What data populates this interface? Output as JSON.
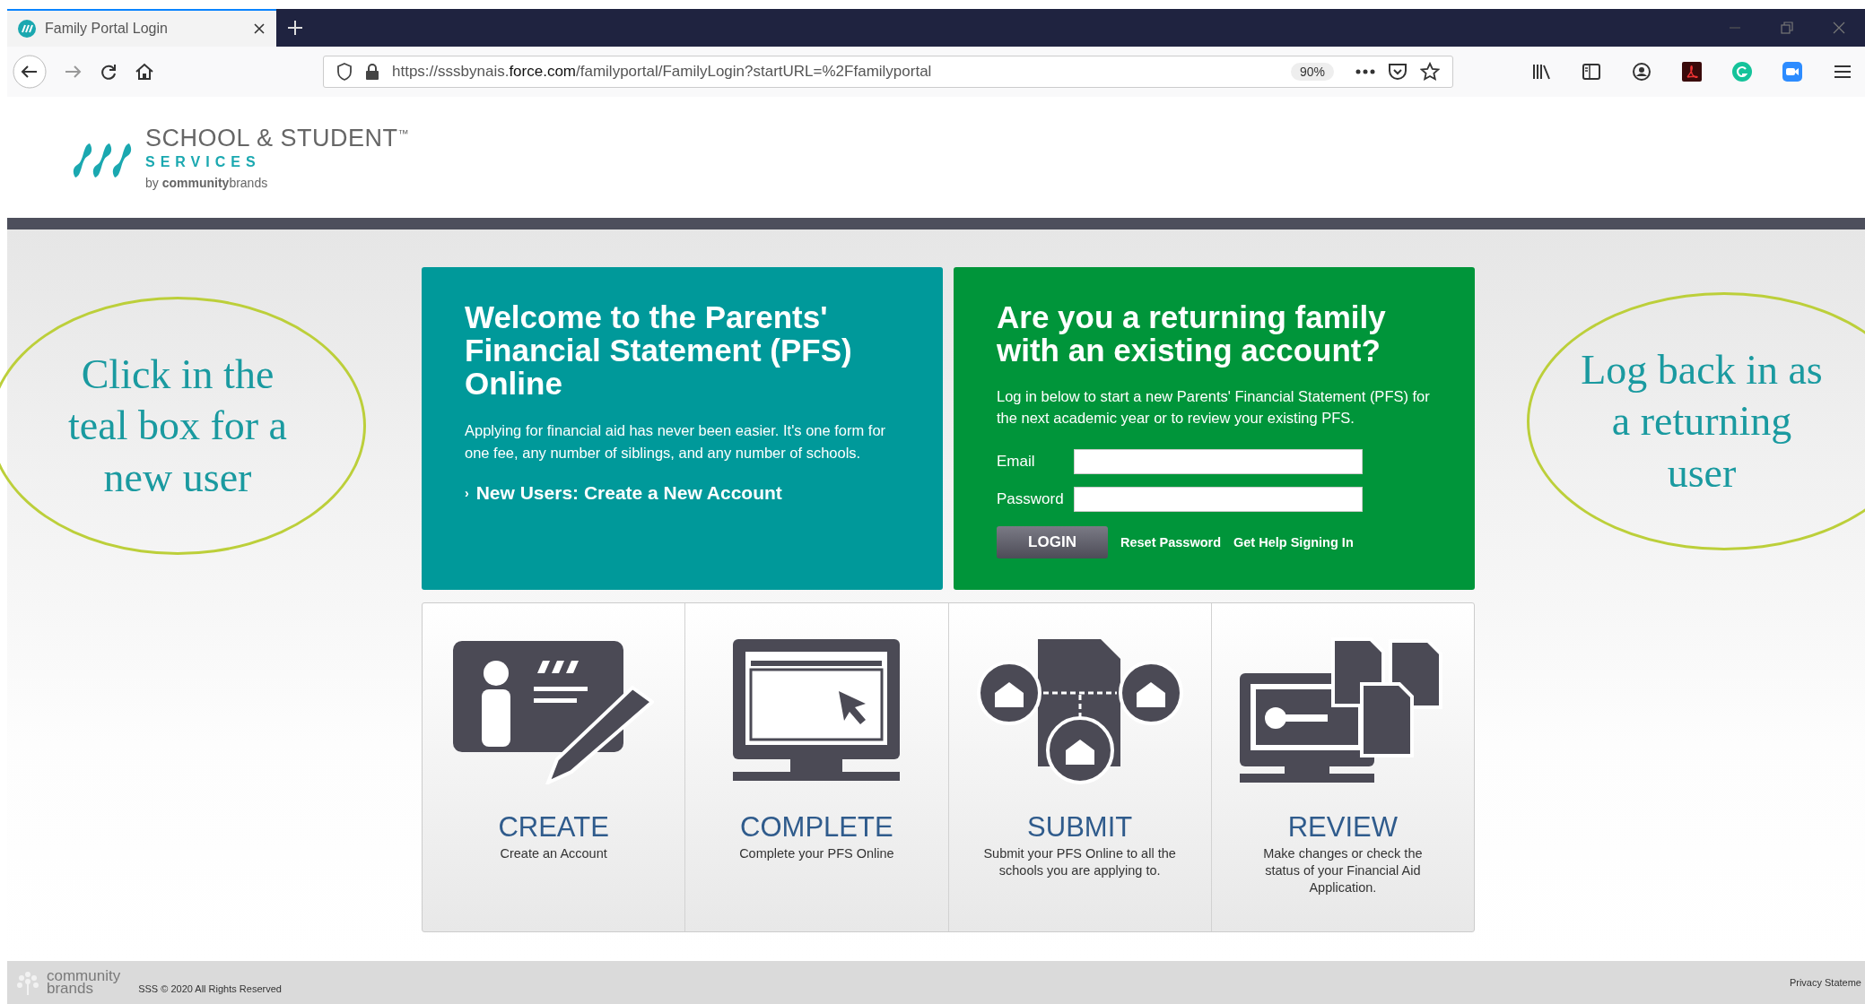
{
  "browser": {
    "tab": {
      "title": "Family Portal Login",
      "selected": true
    },
    "url": "https://sssbynais.**force.com**/familyportal/FamilyLogin?startURL=%2Ffamilyportal",
    "zoom": "90%"
  },
  "logo": {
    "title": "SCHOOL & STUDENT",
    "trademark": "™",
    "subtitle": "SERVICES",
    "byline": "by **community**brands"
  },
  "welcome": {
    "title": "Welcome to the Parents' Financial Statement (PFS) Online",
    "body": "Applying for financial aid has never been easier. It's one form for one fee, any number of siblings, and any number of schools.",
    "bullet": "›",
    "link": "New Users: Create a New Account"
  },
  "login": {
    "title": "Are you a returning family with an existing account?",
    "body": "Log in below to start a new Parents' Financial Statement (PFS) for the next academic year or to review your existing PFS.",
    "email_label": "Email",
    "password_label": "Password",
    "button": "LOGIN",
    "links": [
      "Reset Password",
      "Get Help Signing In"
    ]
  },
  "steps": [
    {
      "kind": "create",
      "title": "CREATE",
      "description": "Create an Account"
    },
    {
      "kind": "complete",
      "title": "COMPLETE",
      "description": "Complete your PFS Online"
    },
    {
      "kind": "submit",
      "title": "SUBMIT",
      "description": "Submit your PFS Online to all the schools you are applying to."
    },
    {
      "kind": "review",
      "title": "REVIEW",
      "description": "Make changes or check the status of your Financial Aid Application."
    }
  ],
  "footer": {
    "brand": [
      "community",
      "brands"
    ],
    "copyright": "SSS © 2020 All Rights Reserved",
    "privacy": "Privacy Stateme"
  },
  "annotations": [
    {
      "kind": "left",
      "text": "Click in the teal box for a new user"
    },
    {
      "kind": "right",
      "text": "Log back in as a returning user"
    }
  ]
}
